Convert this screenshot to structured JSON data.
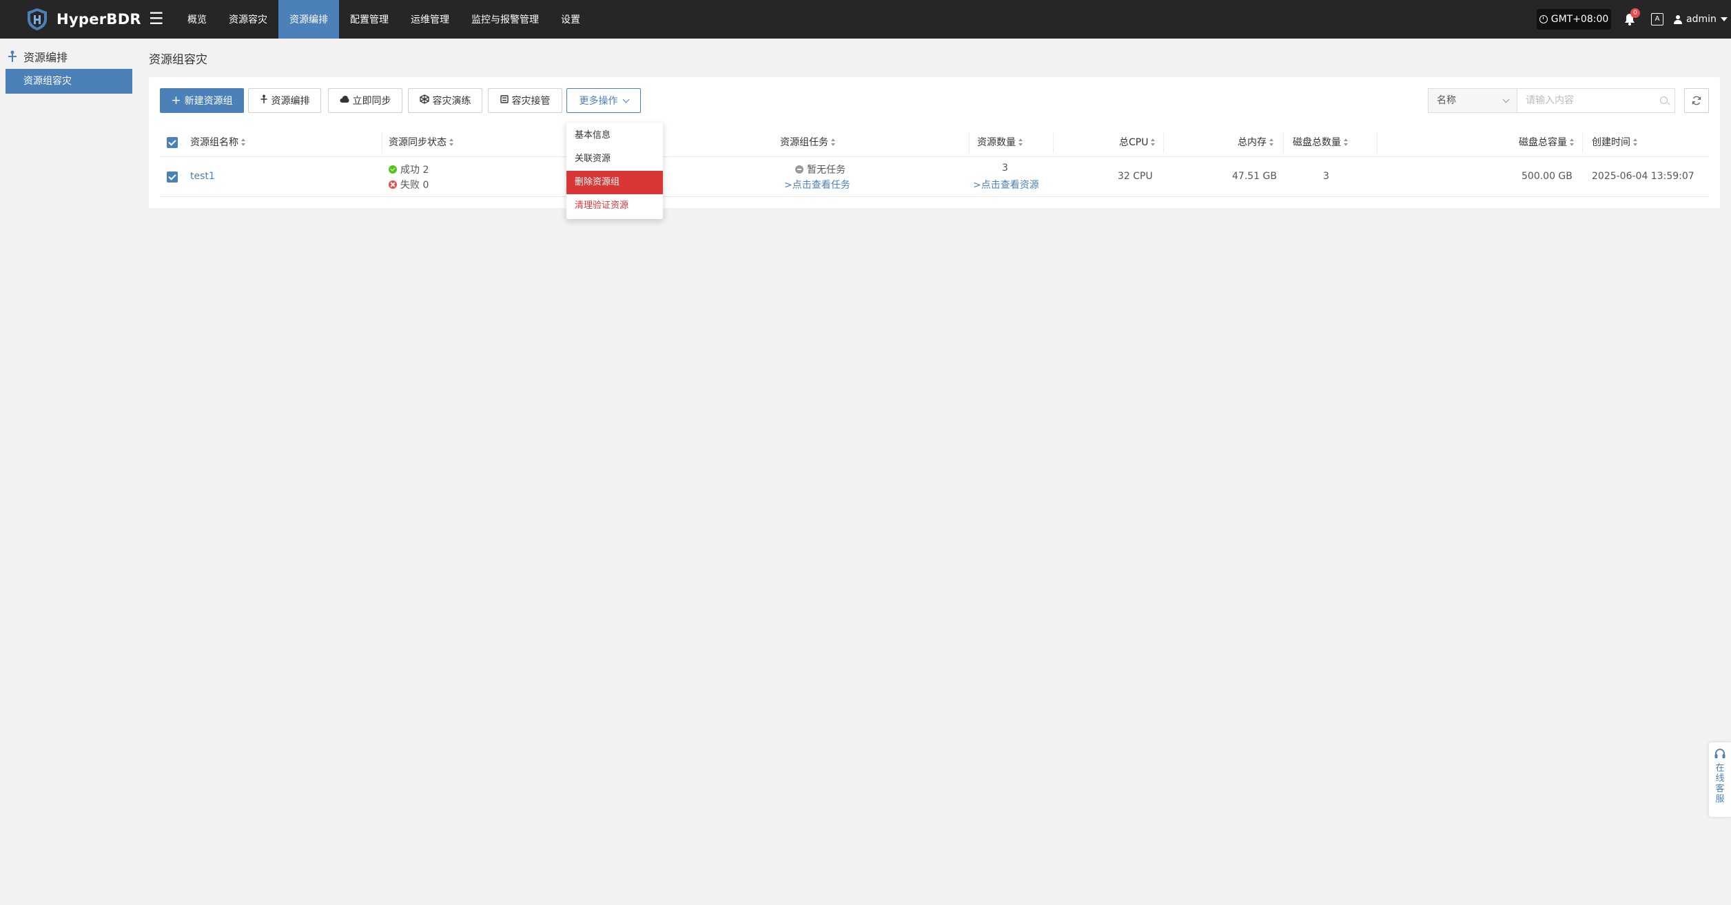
{
  "app": {
    "name": "HyperBDR"
  },
  "nav": {
    "items": [
      {
        "label": "概览"
      },
      {
        "label": "资源容灾"
      },
      {
        "label": "资源编排"
      },
      {
        "label": "配置管理"
      },
      {
        "label": "运维管理"
      },
      {
        "label": "监控与报警管理"
      },
      {
        "label": "设置"
      }
    ],
    "active_index": 2
  },
  "header": {
    "timezone": "GMT+08:00",
    "notification_count": "0",
    "lang_label": "A",
    "user": "admin"
  },
  "sidebar": {
    "section": "资源编排",
    "items": [
      {
        "label": "资源组容灾"
      }
    ]
  },
  "page": {
    "title": "资源组容灾"
  },
  "toolbar": {
    "new_group": "新建资源组",
    "orchestrate": "资源编排",
    "sync_now": "立即同步",
    "dr_drill": "容灾演练",
    "dr_takeover": "容灾接管",
    "more_actions": "更多操作"
  },
  "search": {
    "field_selected": "名称",
    "placeholder": "请输入内容"
  },
  "table": {
    "columns": [
      "资源组名称",
      "资源同步状态",
      "资源组任务",
      "资源数量",
      "总CPU",
      "总内存",
      "磁盘总数量",
      "磁盘总容量",
      "创建时间"
    ],
    "rows": [
      {
        "name": "test1",
        "sync_success": "成功 2",
        "sync_failed": "失败 0",
        "task_status": "暂无任务",
        "task_link": ">点击查看任务",
        "resource_count": "3",
        "resource_link": ">点击查看资源",
        "cpu": "32 CPU",
        "memory": "47.51 GB",
        "disk_count": "3",
        "disk_capacity": "500.00 GB",
        "created": "2025-06-04 13:59:07"
      }
    ]
  },
  "dropdown": {
    "items": [
      {
        "label": "基本信息"
      },
      {
        "label": "关联资源"
      },
      {
        "label": "删除资源组"
      },
      {
        "label": "清理验证资源"
      }
    ]
  },
  "service": {
    "label": "在线客服"
  },
  "colors": {
    "primary": "#4b80b8",
    "topbar": "#262626",
    "danger": "#d93636",
    "success": "#52c41a"
  }
}
